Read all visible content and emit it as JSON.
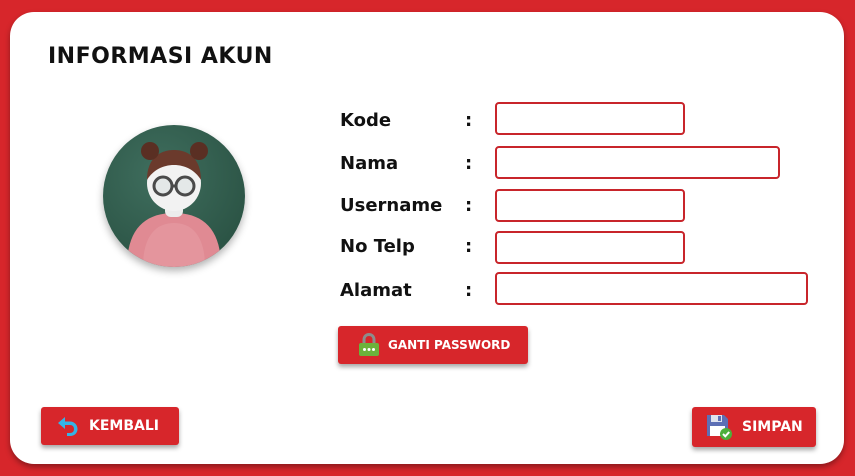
{
  "header": {
    "title": "INFORMASI AKUN"
  },
  "form": {
    "fields": [
      {
        "label": "Kode",
        "colon": ":",
        "value": ""
      },
      {
        "label": "Nama",
        "colon": ":",
        "value": ""
      },
      {
        "label": "Username",
        "colon": ":",
        "value": ""
      },
      {
        "label": "No Telp",
        "colon": ":",
        "value": ""
      },
      {
        "label": "Alamat",
        "colon": ":",
        "value": ""
      }
    ]
  },
  "buttons": {
    "change_password": {
      "label": "GANTI PASSWORD",
      "icon": "lock-icon"
    },
    "back": {
      "label": "KEMBALI",
      "icon": "undo-arrow-icon"
    },
    "save": {
      "label": "SIMPAN",
      "icon": "floppy-disk-icon"
    }
  },
  "avatar": {
    "icon": "user-avatar-icon"
  },
  "colors": {
    "background": "#d7262b",
    "card": "#ffffff",
    "accent": "#d7262b",
    "field_border": "#c8252b",
    "avatar_bg": "#2d5647"
  }
}
